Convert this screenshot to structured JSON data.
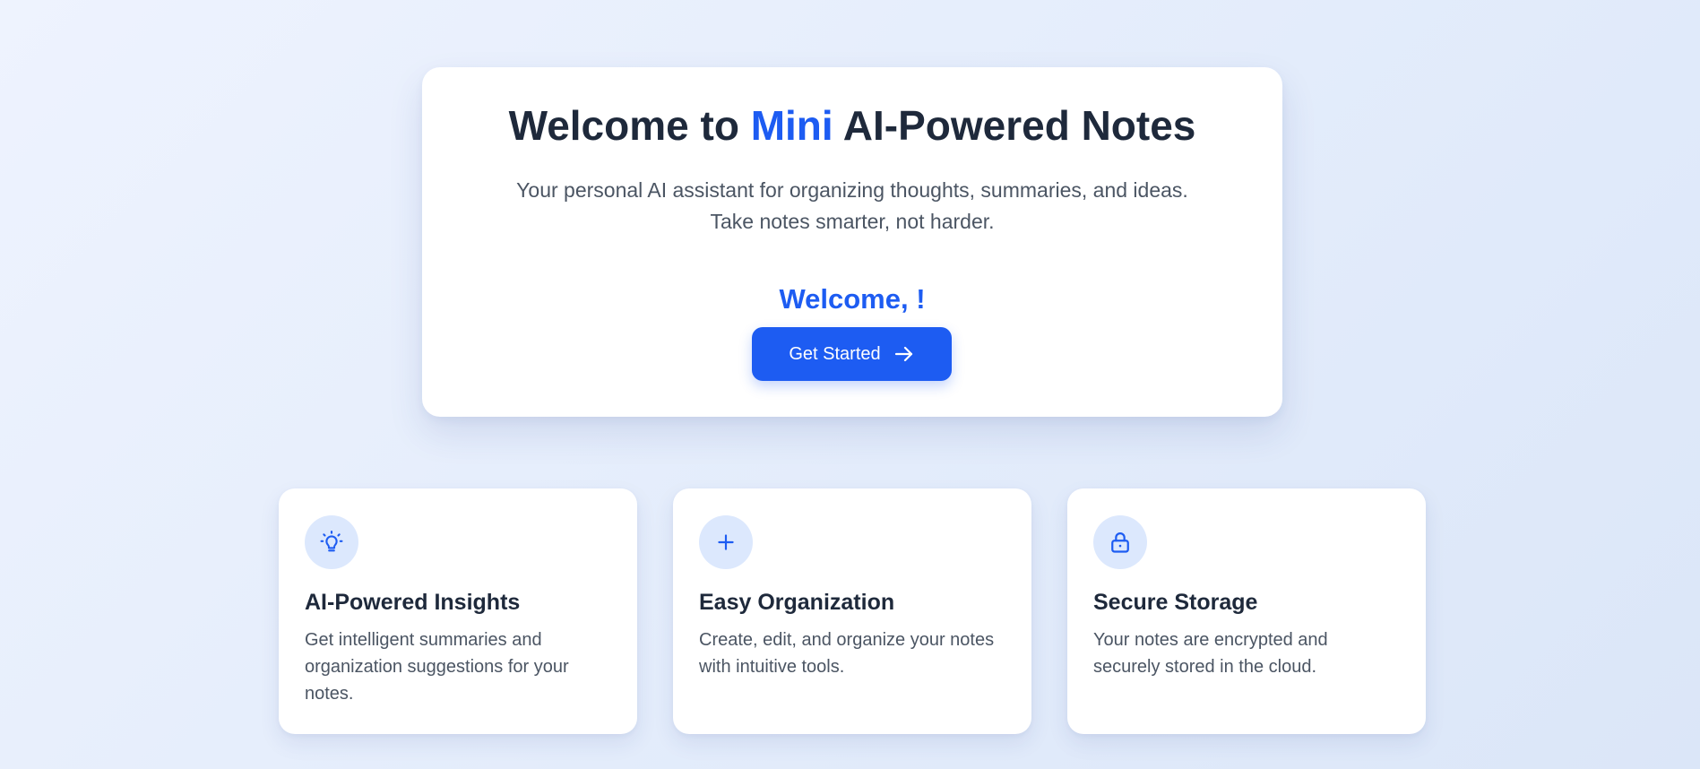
{
  "hero": {
    "title_before": "Welcome to ",
    "title_accent": "Mini",
    "title_after": " AI-Powered Notes",
    "subtitle": "Your personal AI assistant for organizing thoughts, summaries, and ideas. Take notes smarter, not harder.",
    "welcome_text": "Welcome, !",
    "cta_label": "Get Started",
    "cta_icon": "arrow-right-icon"
  },
  "features": [
    {
      "icon": "lightbulb-icon",
      "title": "AI-Powered Insights",
      "description": "Get intelligent summaries and organization suggestions for your notes."
    },
    {
      "icon": "plus-icon",
      "title": "Easy Organization",
      "description": "Create, edit, and organize your notes with intuitive tools."
    },
    {
      "icon": "lock-icon",
      "title": "Secure Storage",
      "description": "Your notes are encrypted and securely stored in the cloud."
    }
  ],
  "colors": {
    "accent": "#1d5cf2",
    "heading": "#1e293b",
    "body_text": "#4b5563",
    "icon_bg": "#dce8fd",
    "page_bg_start": "#eef3fe",
    "page_bg_end": "#dbe6f8"
  }
}
